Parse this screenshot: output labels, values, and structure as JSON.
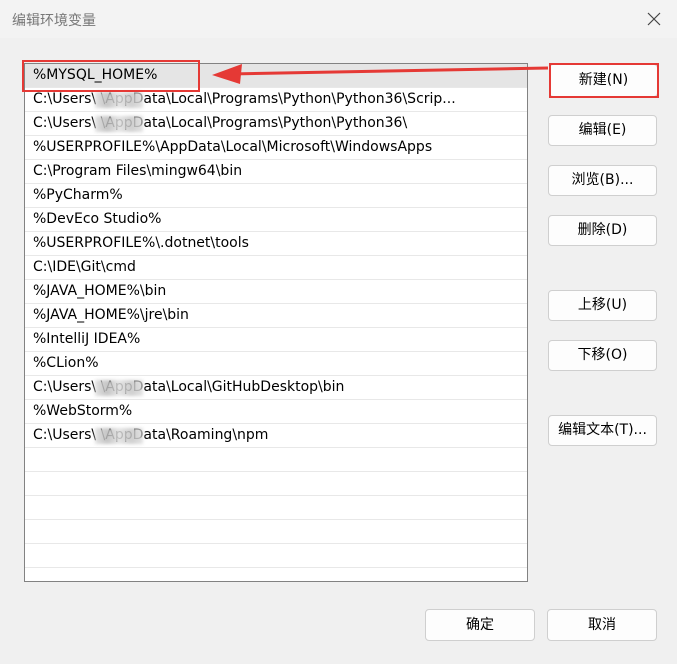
{
  "window": {
    "title": "编辑环境变量",
    "close_icon": "close-icon"
  },
  "path_entries": [
    {
      "text": "%MYSQL_HOME%",
      "selected": true
    },
    {
      "text": "C:\\Users\\        \\AppData\\Local\\Programs\\Python\\Python36\\Scrip..."
    },
    {
      "text": "C:\\Users\\        \\AppData\\Local\\Programs\\Python\\Python36\\"
    },
    {
      "text": "%USERPROFILE%\\AppData\\Local\\Microsoft\\WindowsApps"
    },
    {
      "text": "C:\\Program Files\\mingw64\\bin"
    },
    {
      "text": "%PyCharm%"
    },
    {
      "text": "%DevEco Studio%"
    },
    {
      "text": "%USERPROFILE%\\.dotnet\\tools"
    },
    {
      "text": "C:\\IDE\\Git\\cmd"
    },
    {
      "text": "%JAVA_HOME%\\bin"
    },
    {
      "text": "%JAVA_HOME%\\jre\\bin"
    },
    {
      "text": "%IntelliJ IDEA%"
    },
    {
      "text": "%CLion%"
    },
    {
      "text": "C:\\Users\\        \\AppData\\Local\\GitHubDesktop\\bin"
    },
    {
      "text": "%WebStorm%"
    },
    {
      "text": "C:\\Users\\        \\AppData\\Roaming\\npm"
    }
  ],
  "buttons": {
    "new": "新建(N)",
    "edit": "编辑(E)",
    "browse": "浏览(B)...",
    "delete": "删除(D)",
    "move_up": "上移(U)",
    "move_down": "下移(O)",
    "edit_text": "编辑文本(T)...",
    "ok": "确定",
    "cancel": "取消"
  },
  "annotation": {
    "color": "#e53935"
  }
}
